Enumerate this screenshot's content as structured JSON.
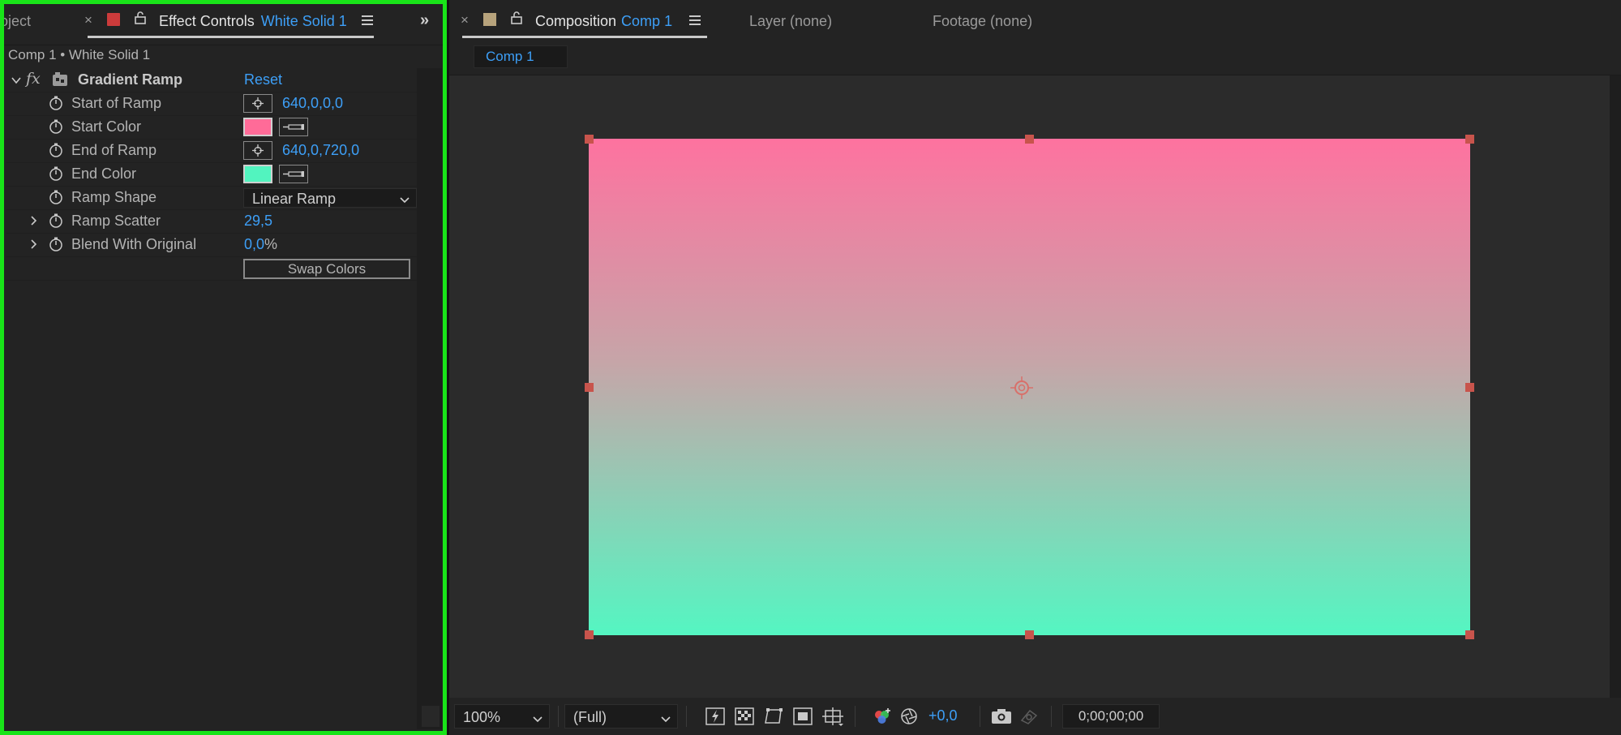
{
  "left_panel": {
    "project_tab_label": "oject",
    "effect_controls_tab": {
      "title": "Effect Controls",
      "layer_name": "White Solid 1",
      "swatch_color": "#cc3b3b"
    },
    "breadcrumb": "Comp 1 • White Solid 1",
    "effect": {
      "name": "Gradient Ramp",
      "reset_label": "Reset",
      "fx_label": "fx",
      "properties": [
        {
          "label": "Start of Ramp",
          "value": "640,0,0,0"
        },
        {
          "label": "Start Color",
          "color": "#ff6b98"
        },
        {
          "label": "End of Ramp",
          "value": "640,0,720,0"
        },
        {
          "label": "End Color",
          "color": "#52f4bf"
        },
        {
          "label": "Ramp Shape",
          "value": "Linear Ramp"
        },
        {
          "label": "Ramp Scatter",
          "value": "29,5"
        },
        {
          "label": "Blend With Original",
          "value": "0,0",
          "unit": "%"
        }
      ],
      "swap_colors_label": "Swap Colors"
    }
  },
  "composition_panel": {
    "tab_title": "Composition",
    "comp_name": "Comp 1",
    "comp_swatch_color": "#b7a37c",
    "layer_tab": "Layer (none)",
    "footage_tab": "Footage (none)",
    "subtab": "Comp 1",
    "canvas_gradient": {
      "top": "#fe729f",
      "bottom": "#54f6c2"
    },
    "toolbar": {
      "zoom": "100%",
      "resolution": "(Full)",
      "exposure": "+0,0",
      "timecode": "0;00;00;00"
    }
  },
  "colors": {
    "accent_blue": "#3d9ff7",
    "highlight_green": "#19e419",
    "handle_red": "#c8544c"
  }
}
